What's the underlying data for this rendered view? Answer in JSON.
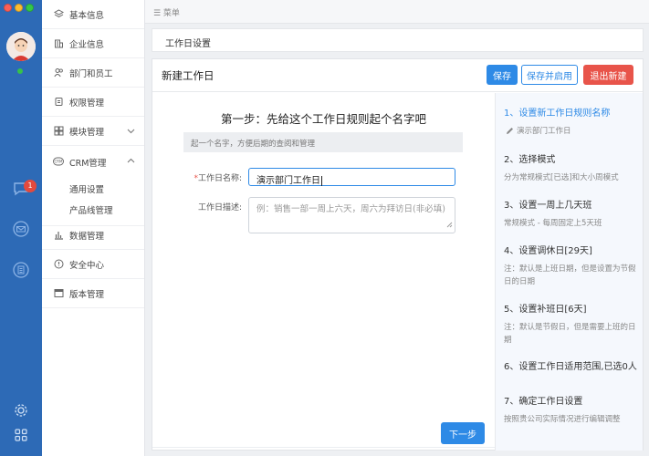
{
  "topbar": {
    "menu_label": "☰ 菜单"
  },
  "rail": {
    "notification_count": "1"
  },
  "sidebar": {
    "items": [
      {
        "label": "基本信息",
        "icon": "layers-icon"
      },
      {
        "label": "企业信息",
        "icon": "building-icon"
      },
      {
        "label": "部门和员工",
        "icon": "people-icon"
      },
      {
        "label": "权限管理",
        "icon": "key-icon"
      },
      {
        "label": "模块管理",
        "icon": "cube-icon"
      },
      {
        "label": "CRM管理",
        "icon": "crm-icon"
      },
      {
        "label": "数据管理",
        "icon": "bar-chart-icon"
      },
      {
        "label": "安全中心",
        "icon": "shield-icon"
      },
      {
        "label": "版本管理",
        "icon": "monitor-icon"
      }
    ],
    "crm_sub": [
      "通用设置",
      "产品线管理"
    ]
  },
  "breadcrumb": {
    "label": "工作日设置"
  },
  "panel": {
    "title": "新建工作日",
    "buttons": {
      "save": "保存",
      "save_enable": "保存并启用",
      "exit": "退出新建"
    },
    "step_title": "第一步：先给这个工作日规则起个名字吧",
    "hint": "起一个名字，方便后期的查阅和管理",
    "name_label": "工作日名称:",
    "name_required": "*",
    "name_value": "演示部门工作日",
    "desc_label": "工作日描述:",
    "desc_placeholder": "例：销售一部一周上六天，周六为拜访日(非必填)",
    "next": "下一步"
  },
  "steps": [
    {
      "title": "1、设置新工作日规则名称",
      "desc": "演示部门工作日",
      "active": true
    },
    {
      "title": "2、选择模式",
      "desc": "分为常规模式[已选]和大小周模式"
    },
    {
      "title": "3、设置一周上几天班",
      "desc": "常规模式 - 每周固定上5天班"
    },
    {
      "title": "4、设置调休日[29天]",
      "desc": "注：默认是上班日期，但是设置为节假日的日期"
    },
    {
      "title": "5、设置补班日[6天]",
      "desc": "注：默认是节假日，但是需要上班的日期"
    },
    {
      "title": "6、设置工作日适用范围,已选0人",
      "desc": ""
    },
    {
      "title": "7、确定工作日设置",
      "desc": "按照贵公司实际情况进行编辑调整"
    }
  ],
  "colors": {
    "rail": "#2d6ab6",
    "accent": "#2e8ae6",
    "danger": "#e8544a"
  }
}
